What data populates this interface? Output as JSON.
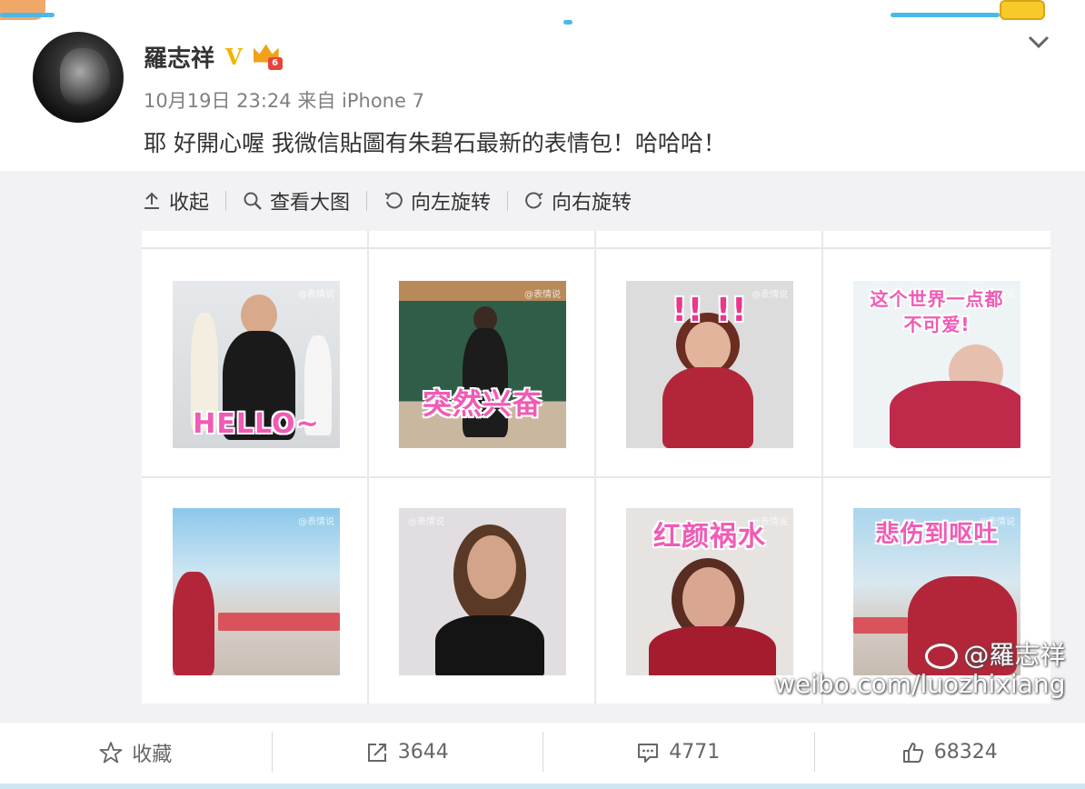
{
  "post": {
    "author": "羅志祥",
    "verified_badge": "V",
    "level_badge": "6",
    "time": "10月19日 23:24",
    "source_prefix": "来自",
    "source": "iPhone 7",
    "text": "耶 好開心喔 我微信貼圖有朱碧石最新的表情包！哈哈哈！"
  },
  "toolbar": {
    "collapse_label": "收起",
    "view_large_label": "查看大图",
    "rotate_left_label": "向左旋转",
    "rotate_right_label": "向右旋转"
  },
  "stickers": [
    {
      "caption": "HELLO~",
      "wm": "@表情说"
    },
    {
      "caption": "突然兴奋",
      "wm": "@表情说"
    },
    {
      "caption": "!!  !!",
      "wm": "@表情说"
    },
    {
      "caption": "这个世界一点都 不可爱!",
      "wm": "@表情说"
    },
    {
      "caption": "",
      "wm": "@表情说"
    },
    {
      "caption": "",
      "wm": "@表情说"
    },
    {
      "caption": "红颜祸水",
      "wm": "@表情说"
    },
    {
      "caption": "悲伤到呕吐",
      "wm": "@表情说"
    }
  ],
  "watermark": {
    "handle": "@羅志祥",
    "url": "weibo.com/luozhixiang"
  },
  "actions": {
    "favorite_label": "收藏",
    "repost_count": "3644",
    "comment_count": "4771",
    "like_count": "68324"
  },
  "colors": {
    "sticker_caption": "#f05bb5",
    "verified": "#f0b400",
    "panel_bg": "#f2f2f5"
  }
}
